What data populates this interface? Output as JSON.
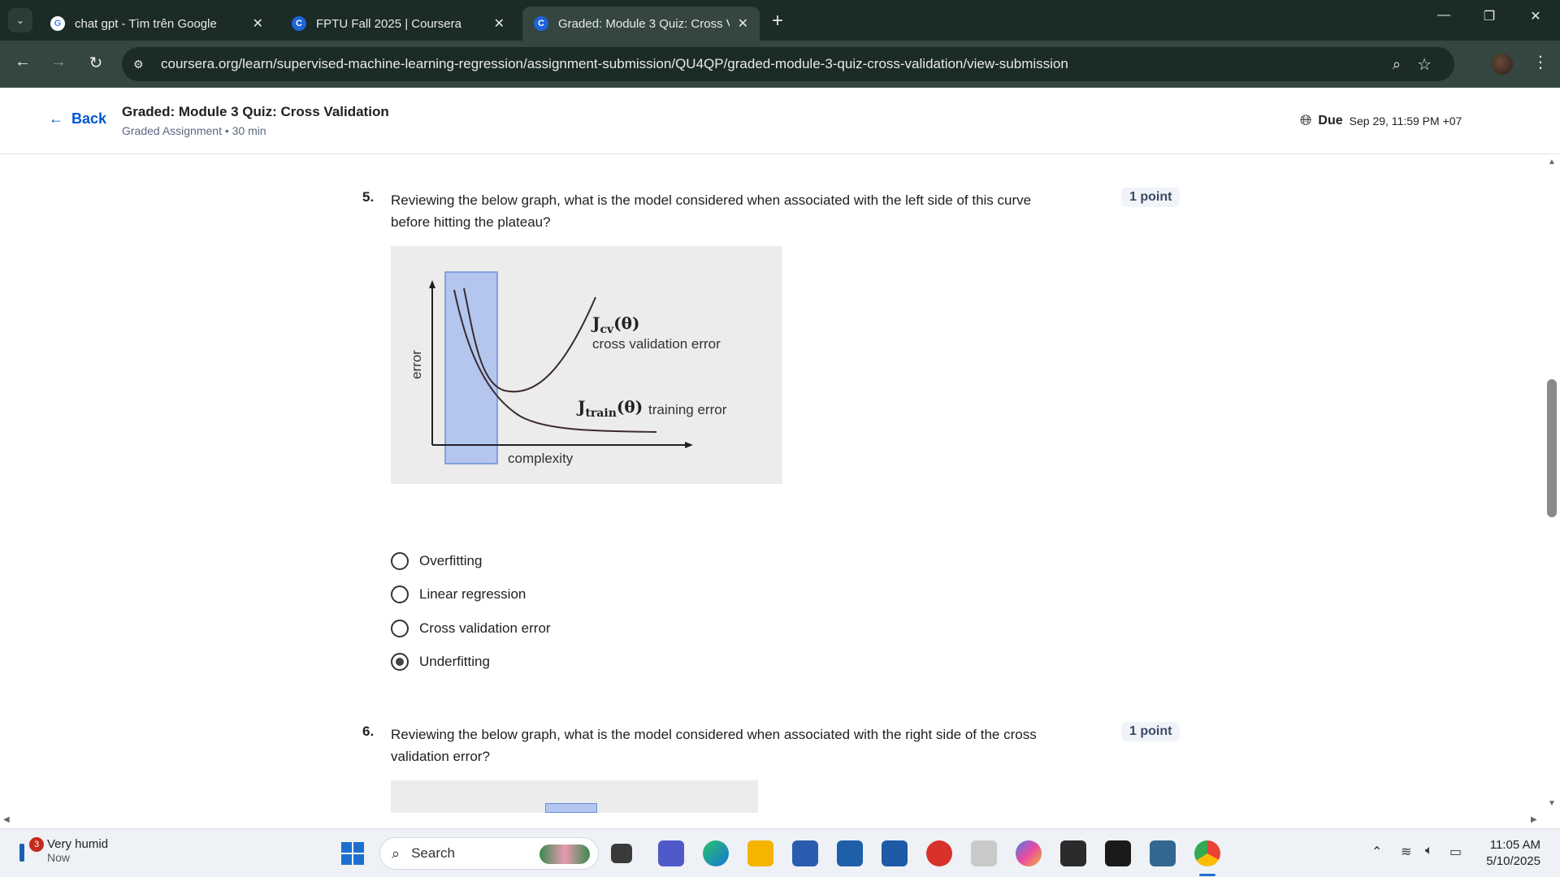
{
  "browser": {
    "tabs": [
      {
        "label": "chat gpt - Tìm trên Google",
        "favicon": "google-icon",
        "active": false
      },
      {
        "label": "FPTU Fall 2025 | Coursera",
        "favicon": "coursera-icon",
        "active": false
      },
      {
        "label": "Graded: Module 3 Quiz: Cross V",
        "favicon": "coursera-icon",
        "active": true
      }
    ],
    "url": "coursera.org/learn/supervised-machine-learning-regression/assignment-submission/QU4QP/graded-module-3-quiz-cross-validation/view-submission"
  },
  "header": {
    "back_label": "Back",
    "title": "Graded: Module 3 Quiz: Cross Validation",
    "subtitle": "Graded Assignment • 30 min",
    "due_label": "Due",
    "due_value": "Sep 29, 11:59 PM +07"
  },
  "questions": [
    {
      "number": "5.",
      "text": "Reviewing the below graph, what is the model considered when associated with the left side of this curve before hitting the plateau?",
      "points": "1 point",
      "figure": {
        "ylabel": "error",
        "xlabel": "complexity",
        "cv_symbol_main": "J",
        "cv_symbol_sub": "cv",
        "cv_symbol_arg": "(θ)",
        "cv_label": "cross validation error",
        "train_symbol_main": "J",
        "train_symbol_sub": "train",
        "train_symbol_arg": "(θ)",
        "train_label": "training error",
        "highlight": "left"
      },
      "options": [
        {
          "label": "Overfitting",
          "checked": false
        },
        {
          "label": "Linear regression",
          "checked": false
        },
        {
          "label": "Cross validation error",
          "checked": false
        },
        {
          "label": "Underfitting",
          "checked": true
        }
      ]
    },
    {
      "number": "6.",
      "text": "Reviewing the below graph, what is the model considered when associated with the right side of the cross validation error?",
      "points": "1 point"
    }
  ],
  "taskbar": {
    "weather_title": "Very humid",
    "weather_sub": "Now",
    "weather_badge": "3",
    "search_label": "Search",
    "time": "11:05 AM",
    "date": "5/10/2025"
  },
  "colors": {
    "accent": "#0056d2",
    "highlight_fill": "#b4c6ee",
    "highlight_stroke": "#6b8fd8",
    "chrome_dark": "#1b2b26",
    "chrome_mid": "#34463f"
  }
}
